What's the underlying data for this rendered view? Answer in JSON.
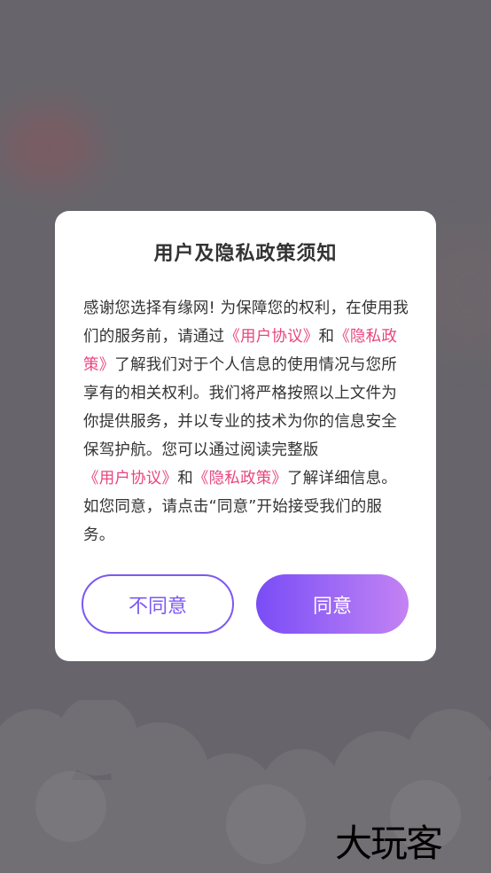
{
  "dialog": {
    "title": "用户及隐私政策须知",
    "body": {
      "seg1": "感谢您选择有缘网! 为保障您的权利，在使用我们的服务前，请通过",
      "link1": "《用户协议》",
      "seg2": "和",
      "link2": "《隐私政策》",
      "seg3": "了解我们对于个人信息的使用情况与您所享有的相关权利。我们将严格按照以上文件为你提供服务，并以专业的技术为你的信息安全保驾护航。您可以通过阅读完整版",
      "link3": "《用户协议》",
      "seg4": "和",
      "link4": "《隐私政策》",
      "seg5": "了解详细信息。如您同意，请点击“同意”开始接受我们的服务。"
    },
    "disagree_label": "不同意",
    "agree_label": "同意"
  },
  "watermark": "大玩客",
  "colors": {
    "overlay": "#67656b",
    "link": "#e8457f",
    "accent": "#7c58f3",
    "gradient_start": "#7a4cf6",
    "gradient_end": "#c482f3"
  }
}
